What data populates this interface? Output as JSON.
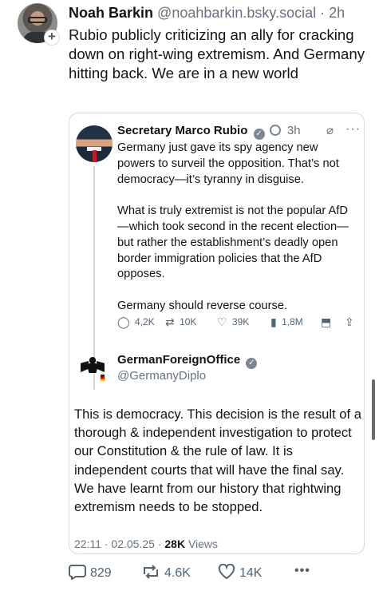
{
  "author": {
    "name": "Noah Barkin",
    "handle": "@noahbarkin.bsky.social",
    "dot": "·",
    "time": "2h"
  },
  "post_text": "Rubio publicly criticizing an ally for cracking down on right-wing extremism. And Germany hitting back. We are in a new world",
  "quoted_post": {
    "author_name": "Secretary Marco Rubio",
    "time": "3h",
    "paragraphs": [
      "Germany just gave its spy agency new powers to surveil the opposition.  That’s not democracy—it’s tyranny in disguise.",
      "What is truly extremist is not the popular AfD—which took second in the recent election—but rather the establishment’s deadly open border immigration policies that the AfD opposes.",
      "Germany should reverse course."
    ],
    "metrics": {
      "replies": "4,2K",
      "reposts": "10K",
      "likes": "39K",
      "views": "1,8M"
    }
  },
  "reply_post": {
    "author_name": "GermanForeignOffice",
    "handle": "@GermanyDiplo",
    "text": "This is democracy. This decision is the result of a thorough & independent investigation to protect our Constitution & the rule of law. It is independent courts that will have the final say. We have learnt from our history that rightwing extremism needs to be stopped.",
    "timestamp": "22:11 · 02.05.25 · ",
    "views_count": "28K",
    "views_label": " Views"
  },
  "actions": {
    "replies": "829",
    "reposts": "4.6K",
    "likes": "14K",
    "more": "•••"
  },
  "colors": {
    "text": "#0f1419",
    "muted": "#66727f",
    "border": "#d3d9de"
  }
}
